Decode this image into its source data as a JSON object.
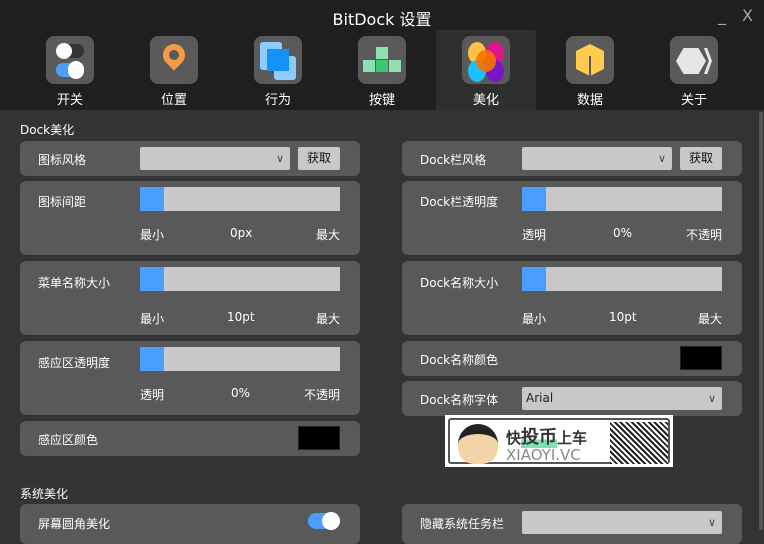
{
  "window": {
    "title": "BitDock 设置",
    "minimize": "_",
    "close": "X"
  },
  "tabs": [
    {
      "label": "开关",
      "icon": "toggle-icon"
    },
    {
      "label": "位置",
      "icon": "location-pin-icon"
    },
    {
      "label": "行为",
      "icon": "copy-icon"
    },
    {
      "label": "按键",
      "icon": "keys-icon"
    },
    {
      "label": "美化",
      "icon": "palette-icon",
      "selected": true
    },
    {
      "label": "数据",
      "icon": "box-icon"
    },
    {
      "label": "关于",
      "icon": "hexagon-icon"
    }
  ],
  "dock": {
    "section": "Dock美化",
    "icon_style": {
      "label": "图标风格",
      "value": "",
      "button": "获取"
    },
    "icon_spacing": {
      "label": "图标间距",
      "min": "最小",
      "value": "0px",
      "max": "最大",
      "fraction": 0
    },
    "menu_font_size": {
      "label": "菜单名称大小",
      "min": "最小",
      "value": "10pt",
      "max": "最大",
      "fraction": 0
    },
    "sense_opacity": {
      "label": "感应区透明度",
      "min": "透明",
      "value": "0%",
      "max": "不透明",
      "fraction": 0
    },
    "sense_color": {
      "label": "感应区颜色",
      "color": "#000000"
    },
    "bar_style": {
      "label": "Dock栏风格",
      "value": "",
      "button": "获取"
    },
    "bar_opacity": {
      "label": "Dock栏透明度",
      "min": "透明",
      "value": "0%",
      "max": "不透明",
      "fraction": 0
    },
    "name_size": {
      "label": "Dock名称大小",
      "min": "最小",
      "value": "10pt",
      "max": "最大",
      "fraction": 0
    },
    "name_color": {
      "label": "Dock名称颜色",
      "color": "#000000"
    },
    "name_font": {
      "label": "Dock名称字体",
      "value": "Arial"
    }
  },
  "ad": {
    "text1": "快",
    "text2": "投币",
    "text3": "上车",
    "text4": "XIAOYI.VC"
  },
  "system": {
    "section": "系统美化",
    "round_corners": {
      "label": "屏幕圆角美化",
      "on": true
    },
    "hide_taskbar": {
      "label": "隐藏系统任务栏",
      "value": ""
    }
  },
  "colors": {
    "accent": "#4a9eff",
    "panel": "#595959",
    "bg": "#333333"
  }
}
